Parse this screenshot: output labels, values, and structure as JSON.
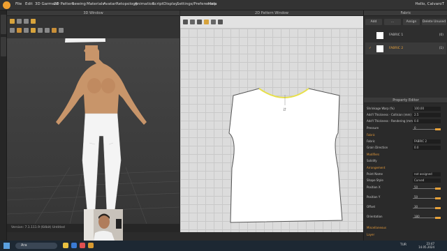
{
  "menu": [
    "File",
    "Edit",
    "3D Garment",
    "2D Pattern",
    "Sewing",
    "Materials",
    "Avatar",
    "Retopology",
    "Animation",
    "Script",
    "Display",
    "Settings/Preferences",
    "Help"
  ],
  "user": "Hello, CalvaroT",
  "win3d": {
    "title": "3D Window",
    "status": "Version: 7.1.111.9 (64bit) Untitled"
  },
  "win2d": {
    "title": "2D Pattern Window"
  },
  "fabric": {
    "title": "Fabric",
    "buttons": [
      "Add",
      "...",
      "Assign",
      "Delete Unused"
    ],
    "items": [
      {
        "name": "FABRIC 1",
        "count": "(0)",
        "checked": false
      },
      {
        "name": "FABRIC 2",
        "count": "(1)",
        "checked": true
      }
    ]
  },
  "property": {
    "title": "Property Editor",
    "rows": [
      {
        "label": "Shrinkage Warp (%)",
        "value": "100.00"
      },
      {
        "label": "Add'l Thickness - Collision (mm)",
        "value": "2.5"
      },
      {
        "label": "Add'l Thickness - Rendering (mm)",
        "value": "0.0"
      },
      {
        "label": "Pressure",
        "value": "0"
      }
    ],
    "fabric_section": "Fabric",
    "fabric_label": "Fabric",
    "fabric_value": "FABRIC 2",
    "grain_label": "Grain Direction",
    "grain_value": "0.0",
    "section_modifiers": "Modifiers",
    "solidify_label": "Solidify",
    "arrangement": "Arrangement",
    "arr_rows": [
      {
        "label": "Point Name",
        "value": "not assigned"
      },
      {
        "label": "Shape Style",
        "value": "Curved"
      },
      {
        "label": "Position X",
        "value": "50"
      },
      {
        "label": "Position Y",
        "value": "50"
      },
      {
        "label": "Offset",
        "value": "30"
      },
      {
        "label": "Orientation",
        "value": "180"
      }
    ],
    "misc": "Miscellaneous",
    "layer": "Layer"
  },
  "taskbar": {
    "search": "Ara",
    "lang": "TUR",
    "time": "23:47",
    "date": "14.05.2024"
  },
  "colors": {
    "accent": "#e8a23a",
    "panel": "#2e2e2e",
    "viewport3d": "#3c3c3c",
    "viewport2d": "#dcdcdc"
  }
}
